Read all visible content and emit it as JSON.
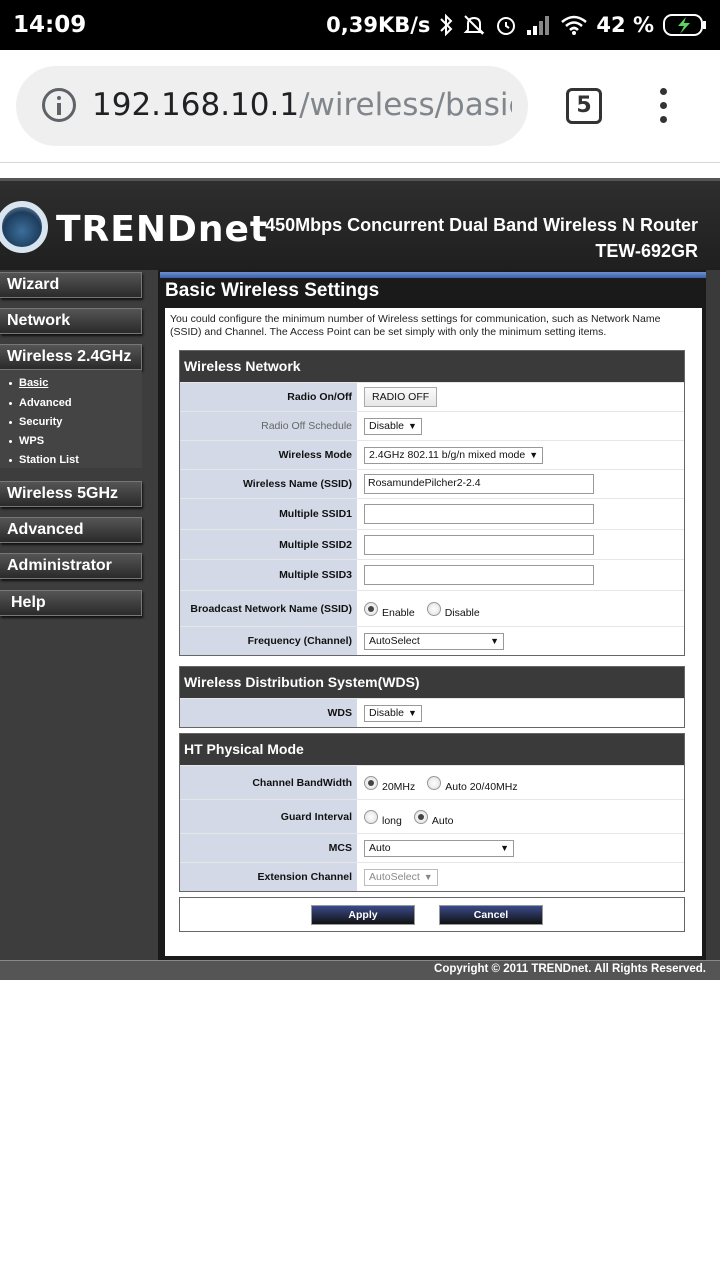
{
  "status_bar": {
    "time": "14:09",
    "network_speed": "0,39KB/s",
    "battery_percent": "42 %",
    "icons": [
      "bluetooth-icon",
      "mute-bell-icon",
      "alarm-icon",
      "signal-icon",
      "wifi-icon",
      "battery-charging-icon"
    ]
  },
  "browser": {
    "url_host": "192.168.10.1",
    "url_path": "/wireless/basic.",
    "tab_count": "5"
  },
  "router": {
    "brand": "TRENDnet",
    "product_title": "450Mbps Concurrent Dual Band Wireless N Router",
    "model": "TEW-692GR",
    "nav": {
      "wizard": "Wizard",
      "network": "Network",
      "wireless24": "Wireless 2.4GHz",
      "wireless5": "Wireless 5GHz",
      "advanced": "Advanced",
      "administrator": "Administrator",
      "help": "Help"
    },
    "subnav": [
      "Basic",
      "Advanced",
      "Security",
      "WPS",
      "Station List"
    ],
    "page_title": "Basic Wireless Settings",
    "description": "You could configure the minimum number of Wireless settings for communication, such as Network Name (SSID) and Channel. The Access Point can be set simply with only the minimum setting items.",
    "wireless_network": {
      "heading": "Wireless Network",
      "radio_label": "Radio On/Off",
      "radio_button": "RADIO OFF",
      "schedule_label": "Radio Off Schedule",
      "schedule_value": "Disable",
      "mode_label": "Wireless Mode",
      "mode_value": "2.4GHz 802.11 b/g/n mixed mode",
      "ssid_label": "Wireless Name (SSID)",
      "ssid_value": "RosamundePilcher2-2.4",
      "ssid1_label": "Multiple SSID1",
      "ssid2_label": "Multiple SSID2",
      "ssid3_label": "Multiple SSID3",
      "broadcast_label": "Broadcast Network Name (SSID)",
      "broadcast_enable": "Enable",
      "broadcast_disable": "Disable",
      "frequency_label": "Frequency (Channel)",
      "frequency_value": "AutoSelect"
    },
    "wds": {
      "heading": "Wireless Distribution System(WDS)",
      "label": "WDS",
      "value": "Disable"
    },
    "ht": {
      "heading": "HT Physical Mode",
      "bandwidth_label": "Channel BandWidth",
      "bandwidth_20": "20MHz",
      "bandwidth_auto": "Auto 20/40MHz",
      "guard_label": "Guard Interval",
      "guard_long": "long",
      "guard_auto": "Auto",
      "mcs_label": "MCS",
      "mcs_value": "Auto",
      "ext_label": "Extension Channel",
      "ext_value": "AutoSelect"
    },
    "apply": "Apply",
    "cancel": "Cancel",
    "copyright": "Copyright © 2011 TRENDnet. All Rights Reserved."
  }
}
